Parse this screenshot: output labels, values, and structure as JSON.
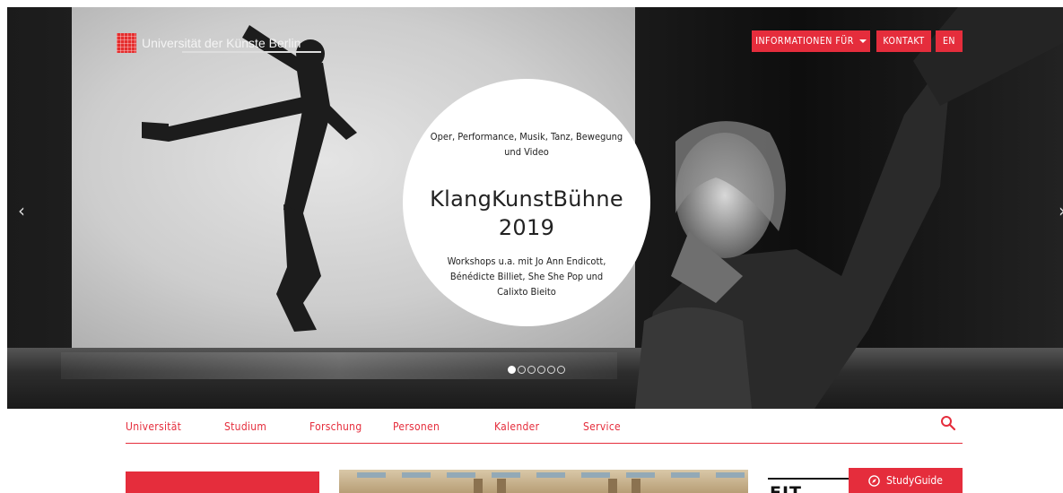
{
  "header": {
    "logo_text": "Universität der Künste Berlin",
    "buttons": {
      "informationen": "INFORMATIONEN FÜR",
      "kontakt": "KONTAKT",
      "language": "EN"
    }
  },
  "slider": {
    "subtitle": "Oper, Performance, Musik, Tanz, Bewegung und Video",
    "title": "KlangKunstBühne 2019",
    "description": "Workshops u.a. mit Jo Ann Endicott, Bénédicte Billiet, She She Pop und Calixto Bieito",
    "prev_icon": "‹",
    "next_icon": "›",
    "dot_count": 6,
    "active_dot": 1
  },
  "nav": {
    "items": [
      "Universität",
      "Studium",
      "Forschung",
      "Personen",
      "Kalender",
      "Service"
    ]
  },
  "studyguide": {
    "label": "StudyGuide"
  },
  "teaser": {
    "fit_text": "FIT"
  },
  "colors": {
    "accent": "#e52d3c",
    "text_dark": "#222222"
  }
}
